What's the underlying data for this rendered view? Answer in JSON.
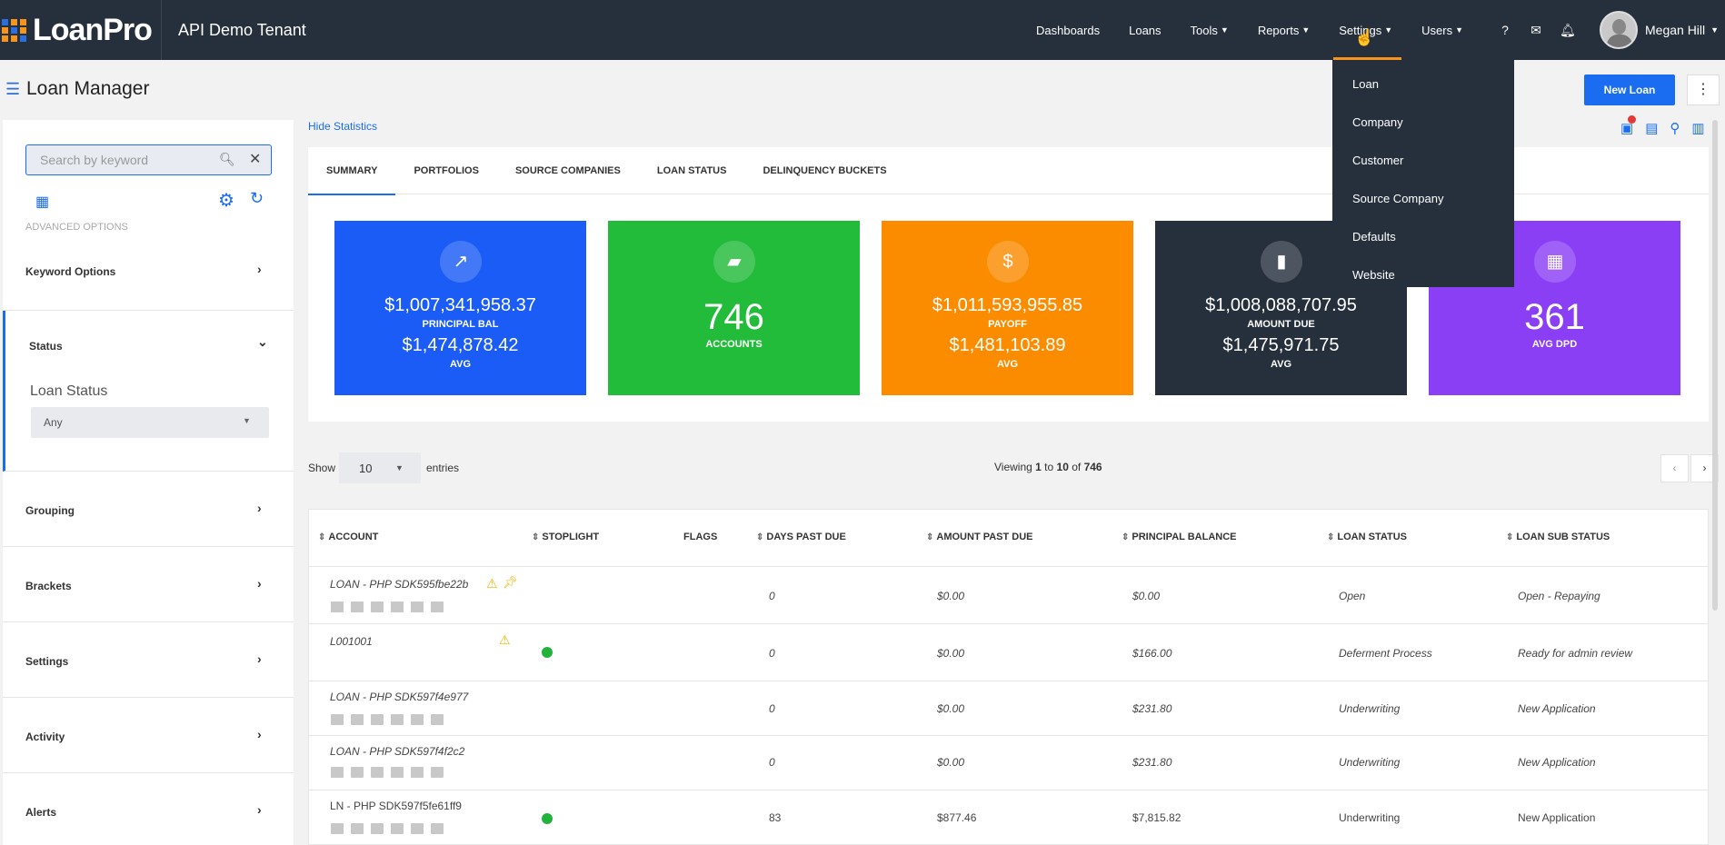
{
  "app": {
    "logo": "LoanPro",
    "tenant": "API Demo Tenant"
  },
  "nav": {
    "dashboards": "Dashboards",
    "loans": "Loans",
    "tools": "Tools",
    "reports": "Reports",
    "settings": "Settings",
    "users": "Users"
  },
  "user": {
    "name": "Megan Hill"
  },
  "settings_menu": [
    "Loan",
    "Company",
    "Customer",
    "Source Company",
    "Defaults",
    "Website"
  ],
  "page": {
    "title": "Loan Manager",
    "new_loan": "New Loan"
  },
  "sidebar": {
    "search_placeholder": "Search by keyword",
    "advanced_options": "ADVANCED OPTIONS",
    "keyword_options": "Keyword Options",
    "status": "Status",
    "loan_status_label": "Loan Status",
    "loan_status_value": "Any",
    "grouping": "Grouping",
    "brackets": "Brackets",
    "settings": "Settings",
    "activity": "Activity",
    "alerts": "Alerts"
  },
  "stats": {
    "hide_label": "Hide Statistics",
    "tabs": [
      "SUMMARY",
      "PORTFOLIOS",
      "SOURCE COMPANIES",
      "LOAN STATUS",
      "DELINQUENCY BUCKETS"
    ],
    "cards": {
      "principal": {
        "value": "$1,007,341,958.37",
        "label": "PRINCIPAL BAL",
        "avg": "$1,474,878.42",
        "avg_label": "AVG",
        "color": "#1a5cf5"
      },
      "accounts": {
        "value": "746",
        "label": "ACCOUNTS",
        "color": "#22bb3a"
      },
      "payoff": {
        "value": "$1,011,593,955.85",
        "label": "PAYOFF",
        "avg": "$1,481,103.89",
        "avg_label": "AVG",
        "color": "#fb8c00"
      },
      "amount_due": {
        "value": "$1,008,088,707.95",
        "label": "AMOUNT DUE",
        "avg": "$1,475,971.75",
        "avg_label": "AVG",
        "color": "#26303d"
      },
      "dpd": {
        "value": "361",
        "label": "AVG DPD",
        "color": "#8a3ff5"
      }
    }
  },
  "table": {
    "show_label": "Show",
    "page_size": "10",
    "entries_label": "entries",
    "viewing_prefix": "Viewing ",
    "viewing_from": "1",
    "viewing_to_word": " to ",
    "viewing_to": "10",
    "viewing_of_word": " of ",
    "viewing_total": "746",
    "headers": {
      "account": "ACCOUNT",
      "stoplight": "STOPLIGHT",
      "flags": "FLAGS",
      "dpd": "DAYS PAST DUE",
      "amount_past_due": "AMOUNT PAST DUE",
      "principal_balance": "PRINCIPAL BALANCE",
      "loan_status": "LOAN STATUS",
      "loan_sub_status": "LOAN SUB STATUS"
    },
    "rows": [
      {
        "account": "LOAN - PHP SDK595fbe22b",
        "dpd": "0",
        "apd": "$0.00",
        "pb": "$0.00",
        "status": "Open",
        "sub": "Open - Repaying"
      },
      {
        "account": "L001001",
        "dpd": "0",
        "apd": "$0.00",
        "pb": "$166.00",
        "status": "Deferment Process",
        "sub": "Ready for admin review"
      },
      {
        "account": "LOAN - PHP SDK597f4e977",
        "dpd": "0",
        "apd": "$0.00",
        "pb": "$231.80",
        "status": "Underwriting",
        "sub": "New Application"
      },
      {
        "account": "LOAN - PHP SDK597f4f2c2",
        "dpd": "0",
        "apd": "$0.00",
        "pb": "$231.80",
        "status": "Underwriting",
        "sub": "New Application"
      },
      {
        "account": "LN - PHP SDK597f5fe61ff9",
        "dpd": "83",
        "apd": "$877.46",
        "pb": "$7,815.82",
        "status": "Underwriting",
        "sub": "New Application"
      }
    ]
  }
}
